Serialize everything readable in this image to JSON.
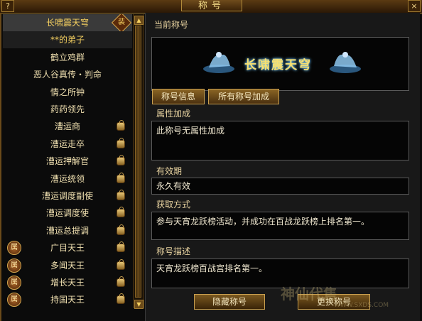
{
  "window": {
    "title": "称号",
    "help_label": "?",
    "close_label": "×"
  },
  "title_list": [
    {
      "label": "长啸震天穹",
      "state": "selected",
      "icon": "title-badge-icon",
      "badge": "装"
    },
    {
      "label": "**的弟子",
      "state": "highlight",
      "icon": null
    },
    {
      "label": "鹤立鸡群",
      "state": "normal",
      "icon": null
    },
    {
      "label": "恶人谷真传・判命",
      "state": "normal",
      "icon": null
    },
    {
      "label": "情之所钟",
      "state": "normal",
      "icon": null
    },
    {
      "label": "药药领先",
      "state": "normal",
      "icon": null
    },
    {
      "label": "漕运商",
      "state": "normal",
      "icon": "lock-icon"
    },
    {
      "label": "漕运走卒",
      "state": "normal",
      "icon": "lock-icon"
    },
    {
      "label": "漕运押解官",
      "state": "normal",
      "icon": "lock-icon"
    },
    {
      "label": "漕运统领",
      "state": "normal",
      "icon": "lock-icon"
    },
    {
      "label": "漕运调度副使",
      "state": "normal",
      "icon": "lock-icon"
    },
    {
      "label": "漕运调度使",
      "state": "normal",
      "icon": "lock-icon"
    },
    {
      "label": "漕运总提调",
      "state": "normal",
      "icon": "lock-icon"
    },
    {
      "label": "广目天王",
      "state": "normal",
      "icon": "lock-icon",
      "left_badge": "属"
    },
    {
      "label": "多闻天王",
      "state": "normal",
      "icon": "lock-icon",
      "left_badge": "属"
    },
    {
      "label": "增长天王",
      "state": "normal",
      "icon": "lock-icon",
      "left_badge": "属"
    },
    {
      "label": "持国天王",
      "state": "normal",
      "icon": "lock-icon",
      "left_badge": "属"
    }
  ],
  "current": {
    "section_label": "当前称号",
    "display_name": "长啸震天穹"
  },
  "tabs": [
    {
      "label": "称号信息",
      "active": true
    },
    {
      "label": "所有称号加成",
      "active": false
    }
  ],
  "attributes": {
    "label": "属性加成",
    "value": "此称号无属性加成"
  },
  "validity": {
    "label": "有效期",
    "value": "永久有效"
  },
  "obtain": {
    "label": "获取方式",
    "value": "参与天宵龙跃榜活动，并成功在百战龙跃榜上排名第一。"
  },
  "description": {
    "label": "称号描述",
    "value": "天宵龙跃榜百战宫排名第一。"
  },
  "buttons": {
    "hide": "隐藏称号",
    "change": "更换称号"
  },
  "watermark": {
    "text": "神仙代售",
    "url": "WWW.SXDS.COM"
  }
}
